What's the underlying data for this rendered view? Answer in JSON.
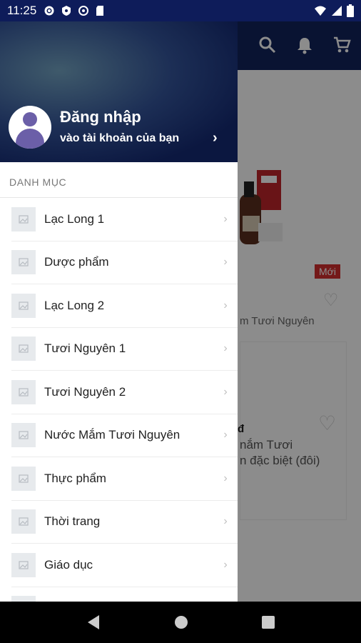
{
  "status_bar": {
    "time": "11:25",
    "icons": [
      "settings-icon",
      "shield-icon",
      "at-sign-icon",
      "sd-card-icon"
    ],
    "right_icons": [
      "wifi-icon",
      "signal-icon",
      "battery-icon"
    ]
  },
  "app_bar": {
    "icons": [
      "search-icon",
      "bell-icon",
      "cart-icon"
    ]
  },
  "background_content": {
    "badge_new": "Mới",
    "product1_name": "m Tươi Nguyên",
    "product2_price": "đ",
    "product2_name_line1": "nắm Tươi",
    "product2_name_line2": "n đặc biệt (đôi)"
  },
  "drawer": {
    "login_title": "Đăng nhập",
    "login_subtitle": "vào tài khoản của bạn",
    "section_title": "DANH MỤC",
    "categories": [
      {
        "label": "Lạc Long 1"
      },
      {
        "label": "Dược phẩm"
      },
      {
        "label": "Lạc Long 2"
      },
      {
        "label": "Tươi Nguyên 1"
      },
      {
        "label": "Tươi Nguyên 2"
      },
      {
        "label": "Nước Mắm Tươi Nguyên"
      },
      {
        "label": "Thực phẩm"
      },
      {
        "label": "Thời trang"
      },
      {
        "label": "Giáo dục"
      }
    ]
  },
  "nav_bar": {
    "buttons": [
      "back-button",
      "home-button",
      "recents-button"
    ]
  },
  "colors": {
    "status_bar": "#0e1c5a",
    "app_bar": "#12235c",
    "badge": "#d32f2f",
    "avatar": "#6b5fa8"
  }
}
